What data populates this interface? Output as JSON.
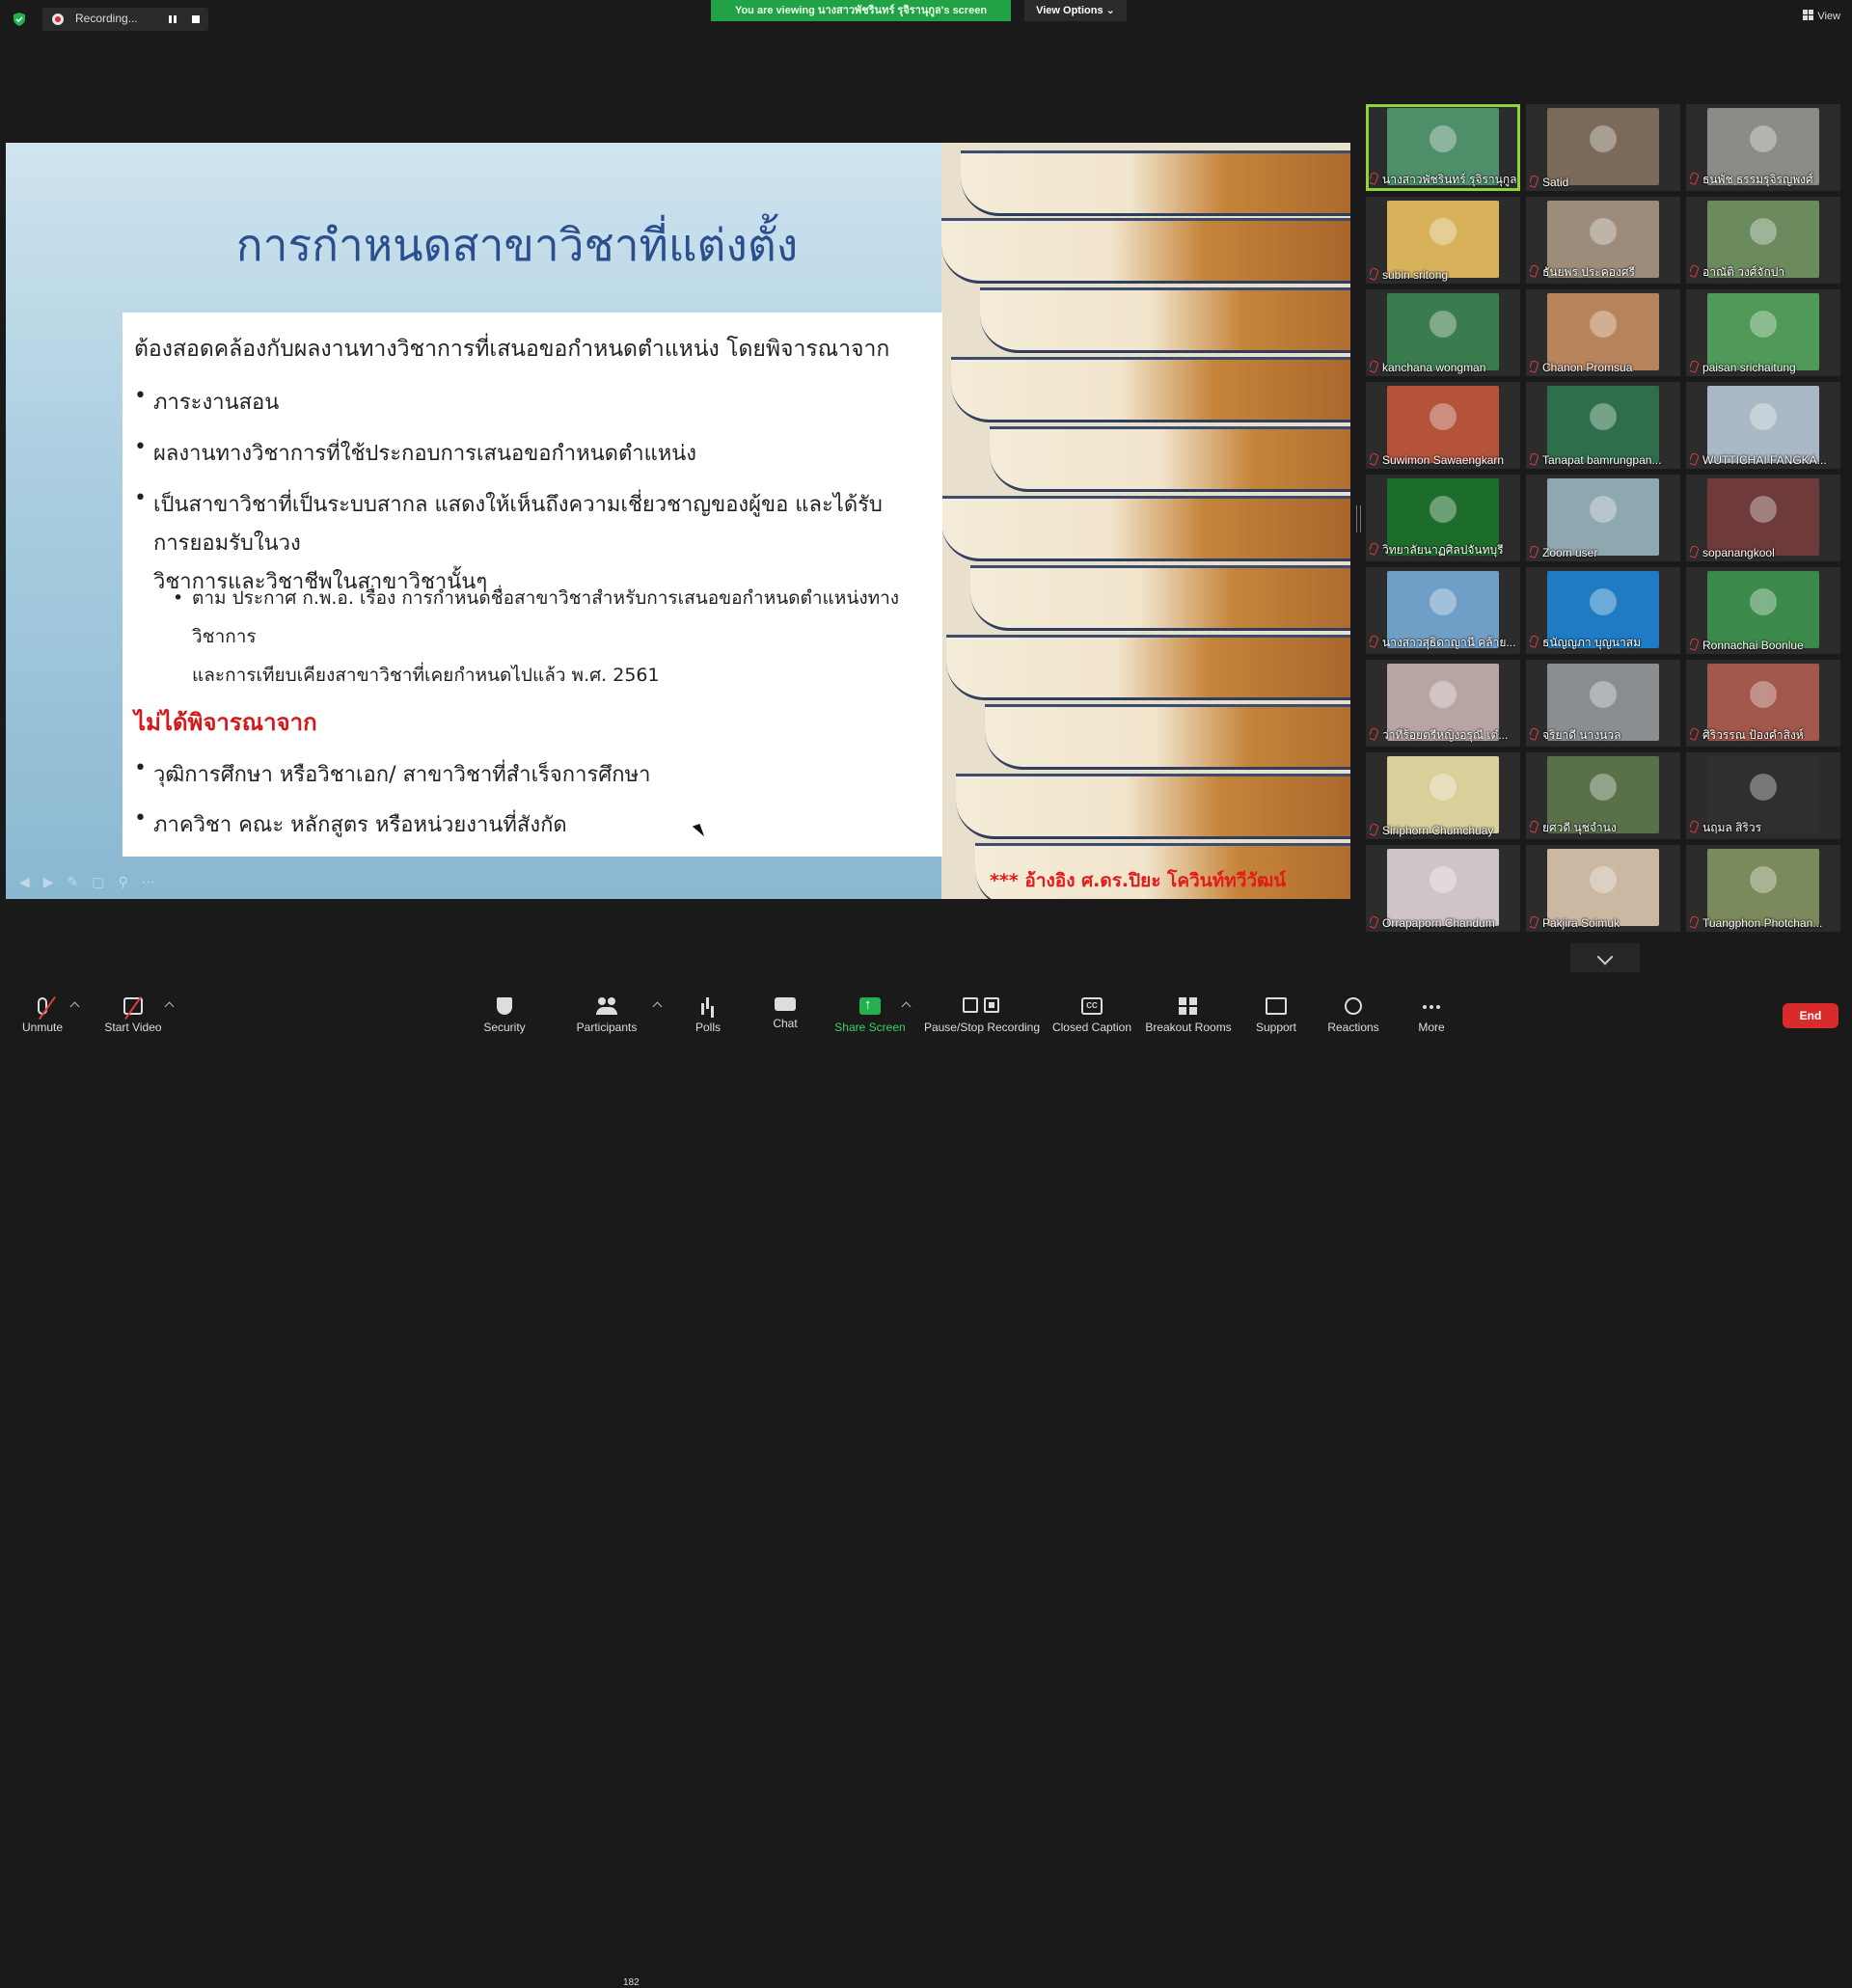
{
  "top_bar": {
    "recording_label": "Recording...",
    "viewing_banner": "You are viewing นางสาวพัชรินทร์ รุจิรานุกูล's screen",
    "view_options_label": "View Options",
    "view_label": "View"
  },
  "slide": {
    "title": "การกำหนดสาขาวิชาที่แต่งตั้ง",
    "intro": "ต้องสอดคล้องกับผลงานทางวิชาการที่เสนอขอกำหนดตำแหน่ง โดยพิจารณาจาก",
    "bullets": [
      "ภาระงานสอน",
      "ผลงานทางวิชาการที่ใช้ประกอบการเสนอขอกำหนดตำแหน่ง",
      "เป็นสาขาวิชาที่เป็นระบบสากล แสดงให้เห็นถึงความเชี่ยวชาญของผู้ขอ และได้รับการยอมรับในวง",
      "วิชาการและวิชาชีพในสาขาวิชานั้นๆ"
    ],
    "sub_bullet_line1": "ตาม ประกาศ ก.พ.อ. เรื่อง การกำหนดชื่อสาขาวิชาสำหรับการเสนอขอกำหนดตำแหน่งทางวิชาการ",
    "sub_bullet_line2": "และการเทียบเคียงสาขาวิชาที่เคยกำหนดไปแล้ว พ.ศ. 2561",
    "not_considered_heading": "ไม่ได้พิจารณาจาก",
    "not_considered": [
      "วุฒิการศึกษา หรือวิชาเอก/ สาขาวิชาที่สำเร็จการศึกษา",
      "ภาควิชา คณะ หลักสูตร หรือหน่วยงานที่สังกัด"
    ],
    "reference": "*** อ้างอิง ศ.ดร.ปิยะ โควินท์ทวีวัฒน์"
  },
  "participants": [
    {
      "name": "นางสาวพัชรินทร์ รุจิรานุกูล",
      "color": "#4e8f6a"
    },
    {
      "name": "Satid",
      "color": "#7b6a5a"
    },
    {
      "name": "ธนพัช ธรรมรุจิรญพงศ์",
      "color": "#8a8a86"
    },
    {
      "name": "subin sritong",
      "color": "#d8b25a"
    },
    {
      "name": "ธันยพร ประคองศรี",
      "color": "#9d8c7a"
    },
    {
      "name": "อาณัติ วงศ์จักปา",
      "color": "#6b8a5e"
    },
    {
      "name": "kanchana wongman",
      "color": "#3b7c4f"
    },
    {
      "name": "Chanon Promsua",
      "color": "#b7845c"
    },
    {
      "name": "paisan srichaitung",
      "color": "#4f9a58"
    },
    {
      "name": "Suwimon Sawaengkarn",
      "color": "#b5533a"
    },
    {
      "name": "Tanapat bamrungpan...",
      "color": "#2f6e4a"
    },
    {
      "name": "WUTTICHAI FANGKA...",
      "color": "#a9b8c4"
    },
    {
      "name": "วิทยาลัยนาฏศิลปจันทบุรี",
      "color": "#1d6d2a"
    },
    {
      "name": "Zoom user",
      "color": "#8fa8b0"
    },
    {
      "name": "sopanangkool",
      "color": "#6e3a3a"
    },
    {
      "name": "นางสาวสุธิดาญานี คล้าย...",
      "color": "#6f9ec6"
    },
    {
      "name": "ธนัญญภา บุญนาสม",
      "color": "#1f7cc4"
    },
    {
      "name": "Ronnachai Boonlue",
      "color": "#3c8a4a"
    },
    {
      "name": "ว่าที่ร้อยตรีหญิงอรุณี เต๋...",
      "color": "#b8a5a2"
    },
    {
      "name": "จริยาดี นางนวล",
      "color": "#8b8e90"
    },
    {
      "name": "ศิริวรรณ ป้องคำสิงห์",
      "color": "#a1574a"
    },
    {
      "name": "Siriphorn Chumchuay",
      "color": "#d9cf9a"
    },
    {
      "name": "ยศวดี นุชจำนง",
      "color": "#59704a"
    },
    {
      "name": "นฤมล สิริวร",
      "color": "#2f2f2f"
    },
    {
      "name": "Orrapaporn Chandum",
      "color": "#cfc4c8"
    },
    {
      "name": "Pakjira Soimuk",
      "color": "#cbb7a2"
    },
    {
      "name": "Tuangphon Photchan...",
      "color": "#7a8a5c"
    }
  ],
  "toolbar": {
    "unmute": "Unmute",
    "start_video": "Start Video",
    "security": "Security",
    "participants": "Participants",
    "participant_count": "182",
    "polls": "Polls",
    "chat": "Chat",
    "share_screen": "Share Screen",
    "pause_stop_recording": "Pause/Stop Recording",
    "closed_caption": "Closed Caption",
    "breakout_rooms": "Breakout Rooms",
    "support": "Support",
    "reactions": "Reactions",
    "more": "More",
    "end": "End",
    "cc_glyph": "CC"
  },
  "colors": {
    "banner_green": "#22a247",
    "active_speaker_border": "#8fd43a",
    "end_red": "#d92b2b",
    "slide_title": "#2b4e8e",
    "slide_red": "#d61818"
  }
}
